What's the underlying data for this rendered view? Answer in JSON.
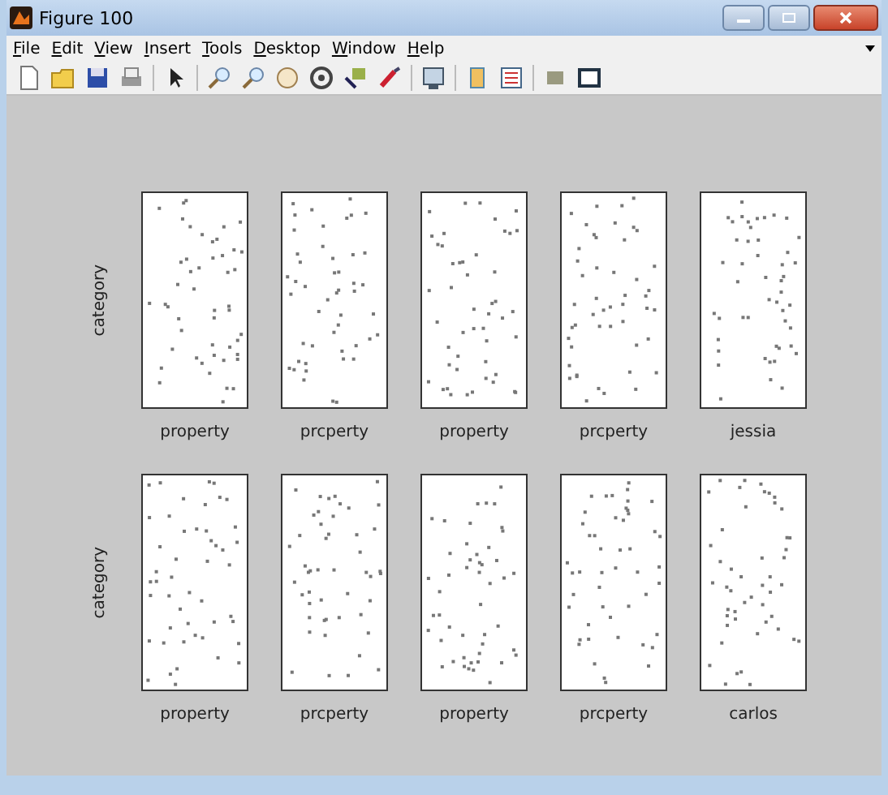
{
  "window": {
    "title": "Figure 100"
  },
  "menu": [
    "File",
    "Edit",
    "View",
    "Insert",
    "Tools",
    "Desktop",
    "Window",
    "Help"
  ],
  "figure": {
    "rows": [
      {
        "ylabel": "category",
        "plots": [
          {
            "xlabel": "property"
          },
          {
            "xlabel": "prcperty"
          },
          {
            "xlabel": "property"
          },
          {
            "xlabel": "prcperty"
          },
          {
            "xlabel": "jessia"
          }
        ]
      },
      {
        "ylabel": "category",
        "plots": [
          {
            "xlabel": "property"
          },
          {
            "xlabel": "prcperty"
          },
          {
            "xlabel": "property"
          },
          {
            "xlabel": "prcperty"
          },
          {
            "xlabel": "carlos"
          }
        ]
      }
    ]
  }
}
